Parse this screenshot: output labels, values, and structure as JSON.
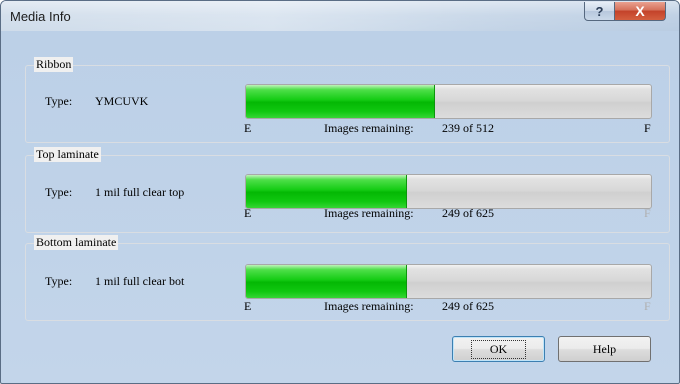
{
  "window": {
    "title": "Media Info",
    "help_glyph": "?",
    "close_glyph": "X"
  },
  "common": {
    "type_label": "Type:",
    "images_remaining_label": "Images remaining:",
    "scale_empty": "E",
    "scale_full": "F"
  },
  "ribbon": {
    "group_label": "Ribbon",
    "type_value": "YMCUVK",
    "remaining_text": "239 of 512",
    "remaining": 239,
    "total": 512
  },
  "top_laminate": {
    "group_label": "Top laminate",
    "type_value": "1 mil full clear top",
    "remaining_text": "249 of 625",
    "remaining": 249,
    "total": 625
  },
  "bottom_laminate": {
    "group_label": "Bottom laminate",
    "type_value": "1 mil full clear bot",
    "remaining_text": "249 of 625",
    "remaining": 249,
    "total": 625
  },
  "buttons": {
    "ok": "OK",
    "help": "Help"
  },
  "colors": {
    "progress_fill": "#14cc14",
    "progress_track": "#d6d6d6",
    "close_button": "#c3422a"
  },
  "icons": {
    "help": "question-mark-icon",
    "close": "close-icon"
  }
}
